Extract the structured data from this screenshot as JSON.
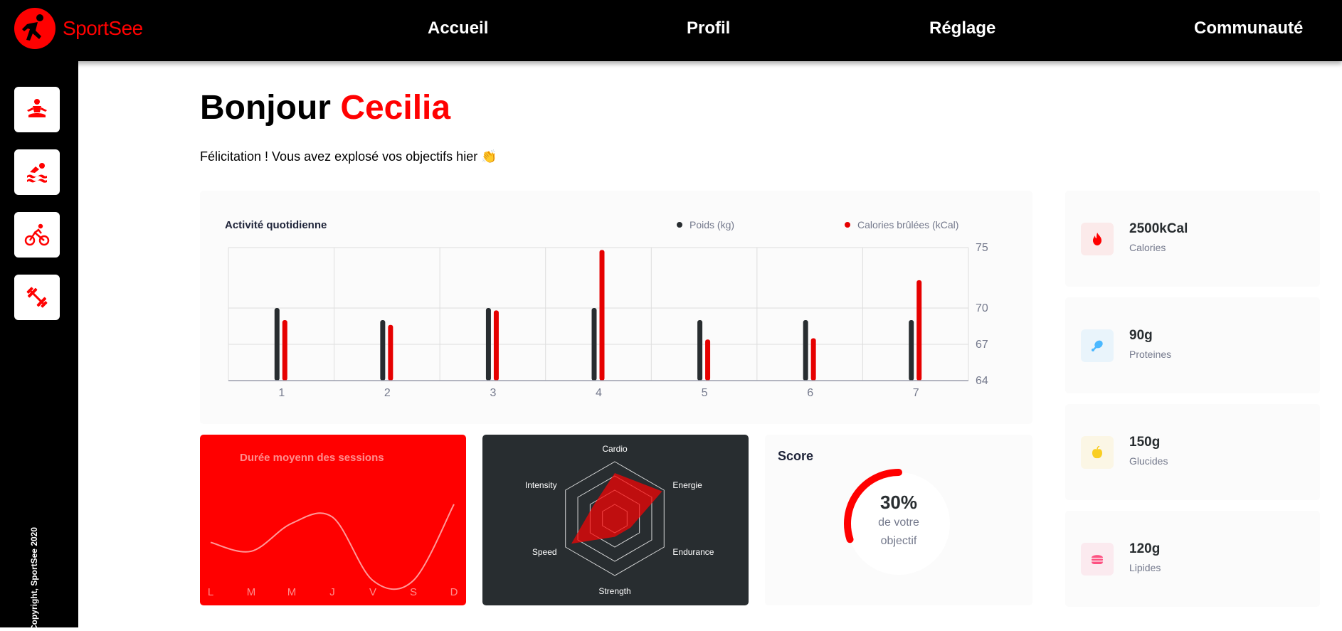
{
  "brand": {
    "name": "SportSee"
  },
  "nav": [
    {
      "label": "Accueil"
    },
    {
      "label": "Profil"
    },
    {
      "label": "Réglage"
    },
    {
      "label": "Communauté"
    }
  ],
  "sidebar": {
    "items": [
      {
        "icon": "yoga-icon"
      },
      {
        "icon": "swimming-icon"
      },
      {
        "icon": "cycling-icon"
      },
      {
        "icon": "dumbbell-icon"
      }
    ],
    "copyright": "Copyright, SportSee 2020"
  },
  "header": {
    "greeting": "Bonjour",
    "name": "Cecilia",
    "message": "Félicitation ! Vous avez explosé vos objectifs hier 👏"
  },
  "colors": {
    "accent": "#ff0101",
    "dark": "#282d30",
    "weight": "#282d30",
    "calories": "#e60000"
  },
  "activity": {
    "title": "Activité quotidienne",
    "legend": [
      {
        "label": "Poids (kg)",
        "color": "#282d30"
      },
      {
        "label": "Calories brûlées (kCal)",
        "color": "#e60000"
      }
    ]
  },
  "durationCard": {
    "title": "Durée moyenn des sessions"
  },
  "scoreCard": {
    "title": "Score",
    "percent": "30%",
    "line1": "de votre",
    "line2": "objectif",
    "value": 0.3
  },
  "keyData": [
    {
      "value": "2500kCal",
      "label": "Calories",
      "icon": "fire-icon",
      "iconColor": "#ff0000",
      "bg": "#fbeaea"
    },
    {
      "value": "90g",
      "label": "Proteines",
      "icon": "chicken-icon",
      "iconColor": "#4ab8ff",
      "bg": "#e9f4fb"
    },
    {
      "value": "150g",
      "label": "Glucides",
      "icon": "apple-icon",
      "iconColor": "#f9ce23",
      "bg": "#fbf6e5"
    },
    {
      "value": "120g",
      "label": "Lipides",
      "icon": "burger-icon",
      "iconColor": "#fd5181",
      "bg": "#fbeaef"
    }
  ],
  "chart_data": [
    {
      "type": "bar",
      "title": "Activité quotidienne",
      "categories": [
        "1",
        "2",
        "3",
        "4",
        "5",
        "6",
        "7"
      ],
      "series": [
        {
          "name": "Poids (kg)",
          "values": [
            70,
            69,
            70,
            70,
            69,
            69,
            69
          ]
        },
        {
          "name": "Calories brûlées (kCal)",
          "values": [
            69,
            68.6,
            69.8,
            74.8,
            67.4,
            67.5,
            72.3
          ]
        }
      ],
      "yticks": [
        64,
        67,
        70,
        75
      ],
      "ylim": [
        64,
        75
      ],
      "grid": true,
      "legend": "top-right"
    },
    {
      "type": "line",
      "title": "Durée moyenn des sessions",
      "categories": [
        "L",
        "M",
        "M",
        "J",
        "V",
        "S",
        "D"
      ],
      "series": [
        {
          "values": [
            30,
            23,
            45,
            50,
            0,
            0,
            60
          ]
        }
      ]
    },
    {
      "type": "radar",
      "categories": [
        "Cardio",
        "Energie",
        "Endurance",
        "Strength",
        "Speed",
        "Intensity"
      ],
      "series": [
        {
          "values": [
            200,
            240,
            80,
            80,
            220,
            110
          ]
        }
      ],
      "rmax": 250
    }
  ]
}
